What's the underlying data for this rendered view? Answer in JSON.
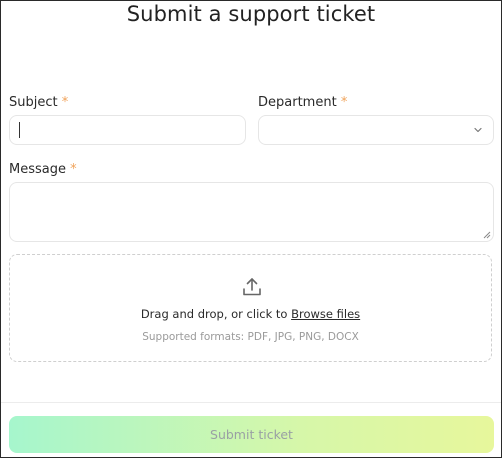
{
  "page": {
    "title": "Submit a support ticket"
  },
  "form": {
    "subject": {
      "label": "Subject",
      "required_mark": "*",
      "value": ""
    },
    "department": {
      "label": "Department",
      "required_mark": "*",
      "value": ""
    },
    "message": {
      "label": "Message",
      "required_mark": "*",
      "value": ""
    },
    "upload": {
      "prompt": "Drag and drop, or click to",
      "browse_label": "Browse files",
      "formats": "Supported formats: PDF, JPG, PNG, DOCX",
      "icon": "upload-icon"
    },
    "submit_label": "Submit ticket"
  },
  "colors": {
    "required": "#f0a35a",
    "submit_gradient_start": "#a6f6cd",
    "submit_gradient_end": "#e7f79c",
    "submit_text": "#9aa0a4"
  }
}
